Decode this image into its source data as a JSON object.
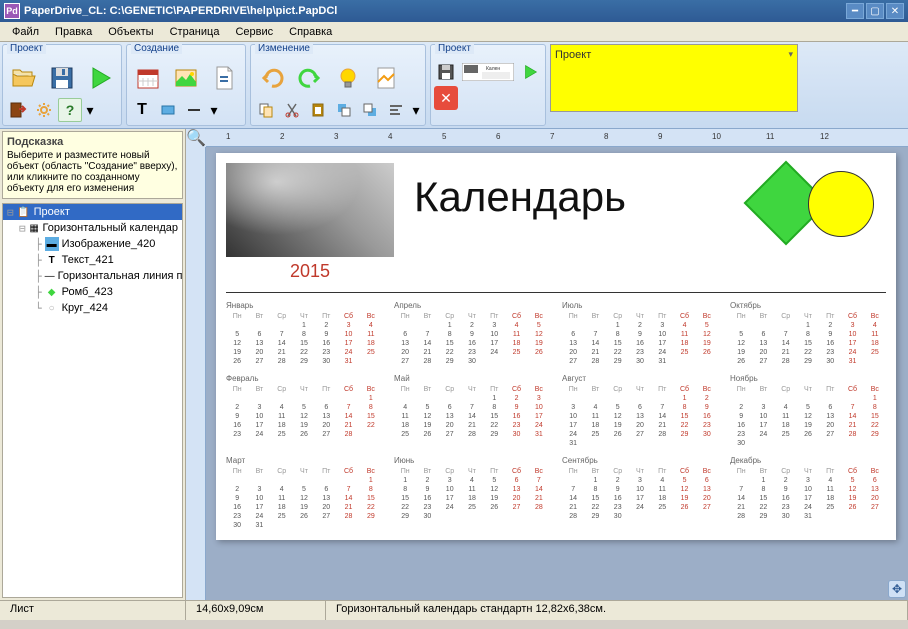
{
  "window": {
    "title": "PaperDrive_CL: C:\\GENETIC\\PAPERDRIVE\\help\\pict.PapDCl",
    "app_initial": "Pd"
  },
  "menu": {
    "file": "Файл",
    "edit": "Правка",
    "objects": "Объекты",
    "page": "Страница",
    "service": "Сервис",
    "help": "Справка"
  },
  "toolbar_groups": {
    "project": "Проект",
    "creation": "Создание",
    "editing": "Изменение",
    "project2": "Проект",
    "panel_label": "Проект"
  },
  "hint": {
    "title": "Подсказка",
    "text": "Выберите и разместите новый объект (область \"Создание\" вверху), или кликните по созданному объекту для его изменения"
  },
  "tree": {
    "root": "Проект",
    "items": [
      "Горизонтальный календар",
      "Изображение_420",
      "Текст_421",
      "Горизонтальная линия при",
      "Ромб_423",
      "Круг_424"
    ]
  },
  "document": {
    "title": "Календарь",
    "year": "2015"
  },
  "months": [
    "Январь",
    "Апрель",
    "Июль",
    "Октябрь",
    "Февраль",
    "Май",
    "Август",
    "Ноябрь",
    "Март",
    "Июнь",
    "Сентябрь",
    "Декабрь"
  ],
  "dow": [
    "Пн",
    "Вт",
    "Ср",
    "Чт",
    "Пт",
    "Сб",
    "Вс"
  ],
  "status": {
    "sheet": "Лист",
    "coords": "14,60x9,09см",
    "object": "Горизонтальный календарь стандартн 12,82x6,38см."
  },
  "ruler_marks": [
    "1",
    "2",
    "3",
    "4",
    "5",
    "6",
    "7",
    "8",
    "9",
    "10",
    "11",
    "12"
  ],
  "colors": {
    "weekend": "#c0392b",
    "rhombus": "#3fd63f",
    "circle": "#ffff00"
  }
}
